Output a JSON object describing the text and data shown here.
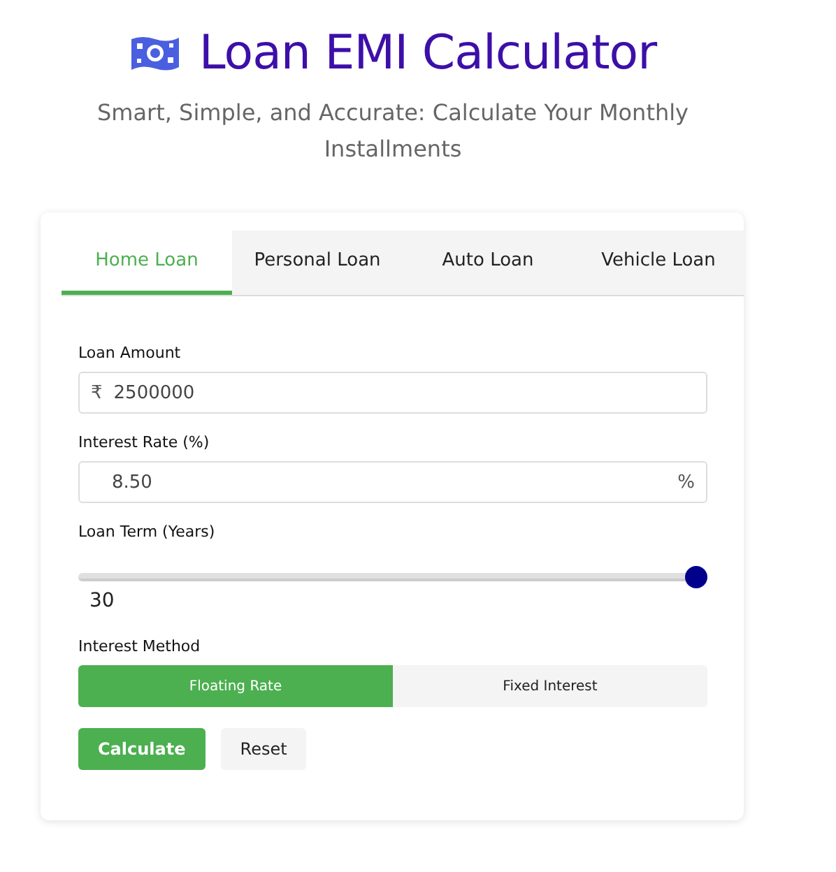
{
  "header": {
    "title": "Loan EMI Calculator",
    "subtitle": "Smart, Simple, and Accurate: Calculate Your Monthly Installments"
  },
  "tabs": [
    {
      "label": "Home Loan",
      "selected": true
    },
    {
      "label": "Personal Loan",
      "selected": false
    },
    {
      "label": "Auto Loan",
      "selected": false
    },
    {
      "label": "Vehicle Loan",
      "selected": false
    }
  ],
  "form": {
    "loan_amount": {
      "label": "Loan Amount",
      "prefix": "₹",
      "value": "2500000"
    },
    "interest_rate": {
      "label": "Interest Rate (%)",
      "value": "8.50",
      "suffix": "%"
    },
    "loan_term": {
      "label": "Loan Term (Years)",
      "level": 1,
      "reading": "30"
    },
    "interest_method": {
      "label": "Interest Method",
      "options": [
        {
          "label": "Floating Rate",
          "selected": true
        },
        {
          "label": "Fixed Interest",
          "selected": false
        }
      ]
    },
    "buttons": [
      {
        "label": "Calculate",
        "kind": "primary"
      },
      {
        "label": "Reset",
        "kind": "secondary"
      }
    ]
  }
}
